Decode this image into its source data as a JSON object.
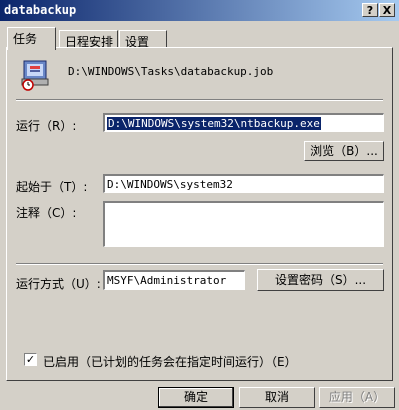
{
  "window": {
    "title": "databackup",
    "help_button": "?",
    "close_button": "X"
  },
  "tabs": [
    {
      "label": "任务"
    },
    {
      "label": "日程安排"
    },
    {
      "label": "设置"
    }
  ],
  "task": {
    "file_path": "D:\\WINDOWS\\Tasks\\databackup.job",
    "run_label": "运行（R）:",
    "run_value": "D:\\WINDOWS\\system32\\ntbackup.exe",
    "browse_label": "浏览（B）...",
    "start_in_label": "起始于（T）:",
    "start_in_value": "D:\\WINDOWS\\system32",
    "comment_label": "注释（C）:",
    "comment_value": "",
    "run_as_label": "运行方式（U）:",
    "run_as_value": "MSYF\\Administrator",
    "set_password_label": "设置密码（S）...",
    "enabled_label": "已启用（已计划的任务会在指定时间运行）（E）",
    "enabled_checked": "✓"
  },
  "footer": {
    "ok_label": "确定",
    "cancel_label": "取消",
    "apply_label": "应用（A）"
  }
}
